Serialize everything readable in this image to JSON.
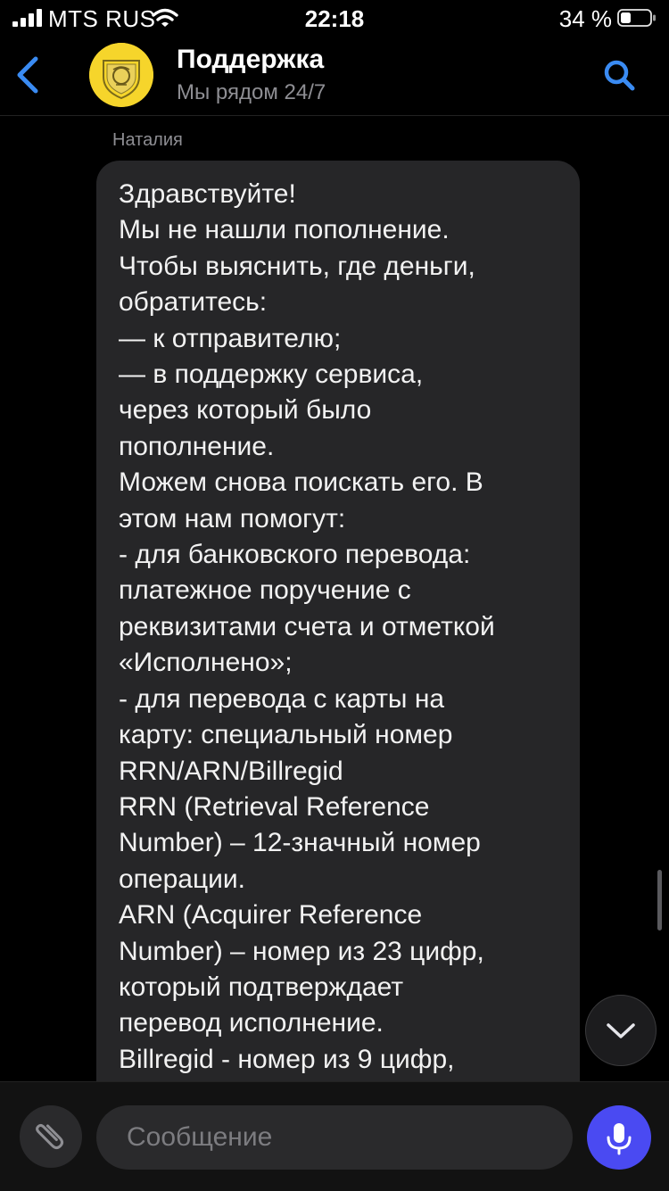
{
  "status": {
    "carrier": "MTS RUS",
    "time": "22:18",
    "battery": "34 %"
  },
  "header": {
    "title": "Поддержка",
    "subtitle": "Мы рядом 24/7",
    "accent": "#3a8bf2",
    "avatar_color": "#f6d52b"
  },
  "chat": {
    "sender": "Наталия",
    "message": "Здравствуйте!\nМы не нашли пополнение.\nЧтобы выяснить, где деньги,\nобратитесь:\n— к отправителю;\n— в поддержку сервиса,\nчерез который было\nпополнение.\nМожем снова поискать его. В\nэтом нам помогут:\n- для банковского перевода:\nплатежное поручение с\nреквизитами счета и отметкой\n«Исполнено»;\n- для перевода с карты на\nкарту: специальный номер\nRRN/ARN/Billregid\nRRN (Retrieval Reference\nNumber) – 12-значный номер\nоперации.\nARN (Acquirer Reference\nNumber) – номер из 23 цифр,\nкоторый подтверждает\nперевод исполнение.\nBillregid - номер из 9 цифр,"
  },
  "composer": {
    "placeholder": "Сообщение",
    "mic_color": "#4a4af2"
  },
  "icons": [
    "signal-icon",
    "wifi-icon",
    "battery-icon",
    "back-chevron-icon",
    "search-icon",
    "chevron-down-icon",
    "paperclip-icon",
    "microphone-icon"
  ]
}
